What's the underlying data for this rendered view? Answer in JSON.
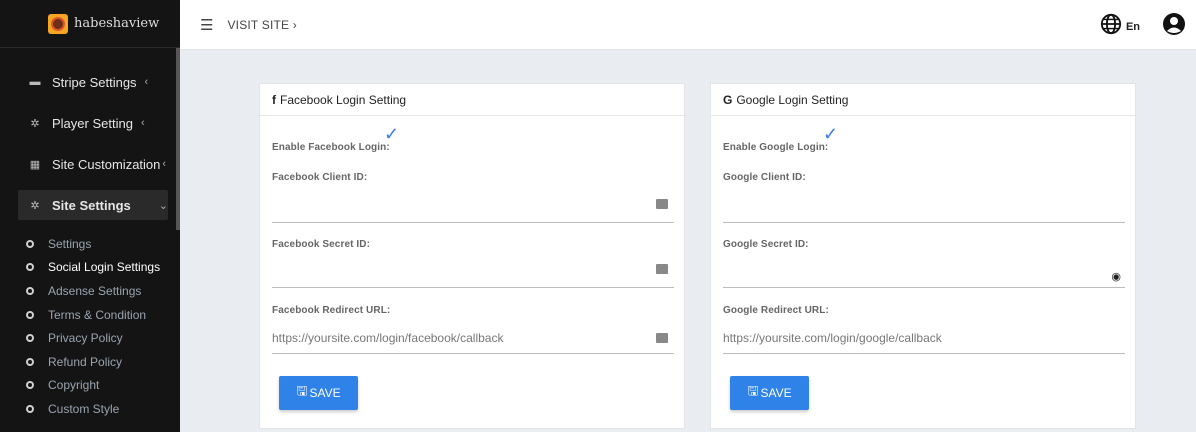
{
  "brand": {
    "name": "habeshaview"
  },
  "sidebar": {
    "items": [
      {
        "label": "Stripe Settings",
        "icon": "card-icon",
        "chevron": "‹"
      },
      {
        "label": "Player Setting",
        "icon": "gear-icon",
        "chevron": "‹"
      },
      {
        "label": "Site Customization",
        "icon": "grid-icon",
        "chevron": "‹"
      },
      {
        "label": "Site Settings",
        "icon": "gear-icon",
        "chevron": "⌄"
      }
    ],
    "subitems": [
      "Settings",
      "Social Login Settings",
      "Adsense Settings",
      "Terms & Condition",
      "Privacy Policy",
      "Refund Policy",
      "Copyright",
      "Custom Style"
    ]
  },
  "topbar": {
    "visit_label": "VISIT SITE ›",
    "lang": "En"
  },
  "facebook": {
    "title": "Facebook Login Setting",
    "brand_icon": "f",
    "enable_label": "Enable Facebook Login:",
    "client_label": "Facebook Client ID:",
    "secret_label": "Facebook Secret ID:",
    "redirect_label": "Facebook Redirect URL:",
    "redirect_value": "https://yoursite.com/login/facebook/callback",
    "save_label": "SAVE"
  },
  "google": {
    "title": "Google Login Setting",
    "brand_icon": "G",
    "enable_label": "Enable Google Login:",
    "client_label": "Google Client ID:",
    "secret_label": "Google Secret ID:",
    "redirect_label": "Google Redirect URL:",
    "redirect_value": "https://yoursite.com/login/google/callback",
    "save_label": "SAVE"
  },
  "colors": {
    "accent": "#2e82e8",
    "check": "#3d7ee0",
    "sidebar": "#141414"
  }
}
